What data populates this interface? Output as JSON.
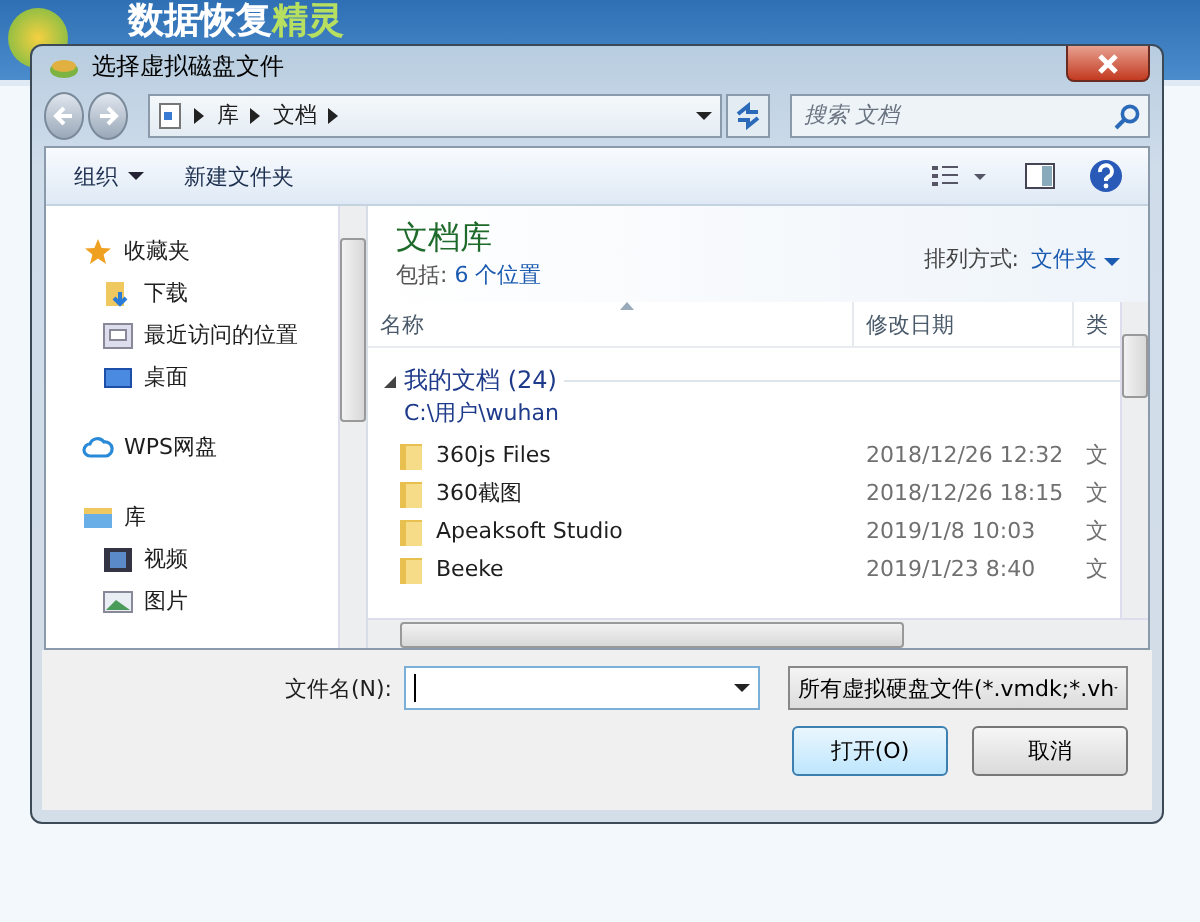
{
  "app": {
    "title_parts": [
      "数据恢复",
      "精灵"
    ]
  },
  "dialog": {
    "title": "选择虚拟磁盘文件"
  },
  "breadcrumb": [
    "库",
    "文档"
  ],
  "search": {
    "placeholder": "搜索 文档"
  },
  "toolbar": {
    "organize": "组织",
    "new_folder": "新建文件夹"
  },
  "nav": [
    {
      "label": "收藏夹",
      "children": [
        {
          "label": "下载"
        },
        {
          "label": "最近访问的位置"
        },
        {
          "label": "桌面"
        }
      ]
    },
    {
      "label": "WPS网盘"
    },
    {
      "label": "库",
      "children": [
        {
          "label": "视频"
        },
        {
          "label": "图片"
        }
      ]
    }
  ],
  "library": {
    "title": "文档库",
    "includes_label": "包括:",
    "includes_link": "6 个位置",
    "arrange_label": "排列方式:",
    "arrange_value": "文件夹"
  },
  "table": {
    "columns": [
      "名称",
      "修改日期",
      "类"
    ],
    "group": {
      "title": "我的文档 (24)",
      "path": "C:\\用户\\wuhan"
    },
    "rows": [
      {
        "name": "360js Files",
        "date": "2018/12/26 12:32",
        "column_3": "文"
      },
      {
        "name": "360截图",
        "date": "2018/12/26 18:15",
        "column_3": "文"
      },
      {
        "name": "Apeaksoft Studio",
        "date": "2019/1/8 10:03",
        "column_3": "文"
      },
      {
        "name": "Beeke",
        "date": "2019/1/23 8:40",
        "column_3": "文"
      }
    ]
  },
  "footer": {
    "filename_label": "文件名(N):",
    "filter": "所有虚拟硬盘文件(*.vmdk;*.vh",
    "open": "打开(O)",
    "cancel": "取消"
  }
}
